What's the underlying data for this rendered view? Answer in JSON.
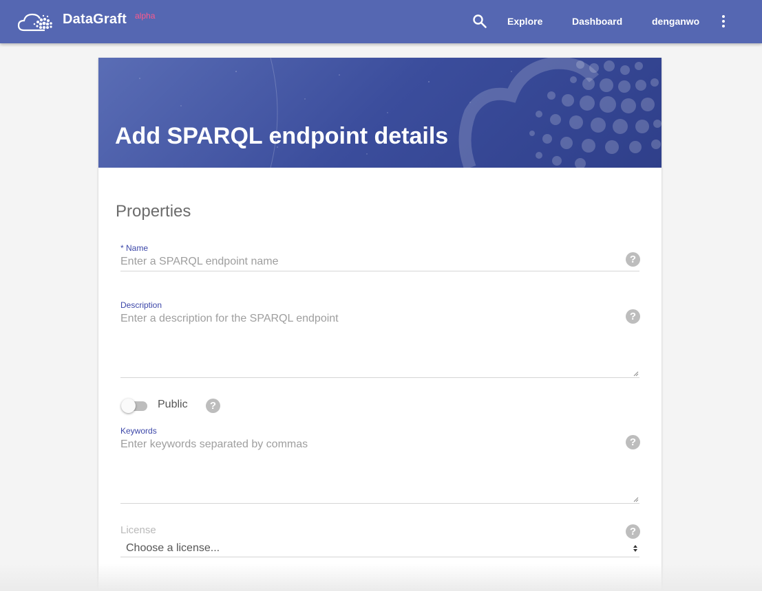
{
  "header": {
    "brand": "DataGraft",
    "brand_tag": "alpha",
    "nav": {
      "explore": "Explore",
      "dashboard": "Dashboard",
      "user": "denganwo"
    },
    "icons": {
      "search": "search-icon",
      "more": "more-vert-icon",
      "logo": "cloud-logo-icon"
    }
  },
  "hero": {
    "title": "Add SPARQL endpoint details"
  },
  "form": {
    "section_title": "Properties",
    "name": {
      "label": "* Name",
      "placeholder": "Enter a SPARQL endpoint name"
    },
    "description": {
      "label": "Description",
      "placeholder": "Enter a description for the SPARQL endpoint"
    },
    "public": {
      "label": "Public",
      "checked": false
    },
    "keywords": {
      "label": "Keywords",
      "placeholder": "Enter keywords separated by commas"
    },
    "license": {
      "label": "License",
      "selected": "Choose a license..."
    },
    "help_glyph": "?"
  },
  "colors": {
    "topbar": "#5567b2",
    "accent_label": "#3b46a8",
    "brand_tag": "#ff5a8c"
  }
}
